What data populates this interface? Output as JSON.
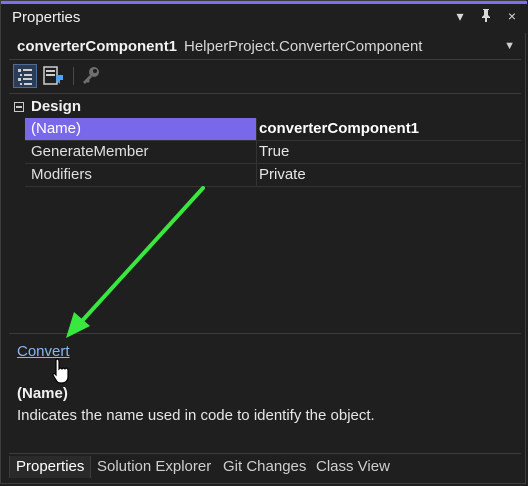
{
  "window": {
    "title": "Properties",
    "controls": [
      "▾",
      "pin",
      "×"
    ]
  },
  "object_selector": {
    "name": "converterComponent1",
    "type": "HelperProject.ConverterComponent"
  },
  "toolbar": {
    "buttons": [
      "categorized-icon",
      "alphabetical-icon",
      "property-pages-icon"
    ]
  },
  "grid": {
    "category": "Design",
    "rows": [
      {
        "name": "(Name)",
        "value": "converterComponent1",
        "selected": true
      },
      {
        "name": "GenerateMember",
        "value": "True",
        "selected": false
      },
      {
        "name": "Modifiers",
        "value": "Private",
        "selected": false
      }
    ]
  },
  "verbs": {
    "convert_label": "Convert"
  },
  "description": {
    "title": "(Name)",
    "text": "Indicates the name used in code to identify the object."
  },
  "tabs": [
    "Properties",
    "Solution Explorer",
    "Git Changes",
    "Class View"
  ],
  "colors": {
    "accent": "#7a68ea",
    "arrow": "#39e83f",
    "link": "#8ab7f0"
  }
}
